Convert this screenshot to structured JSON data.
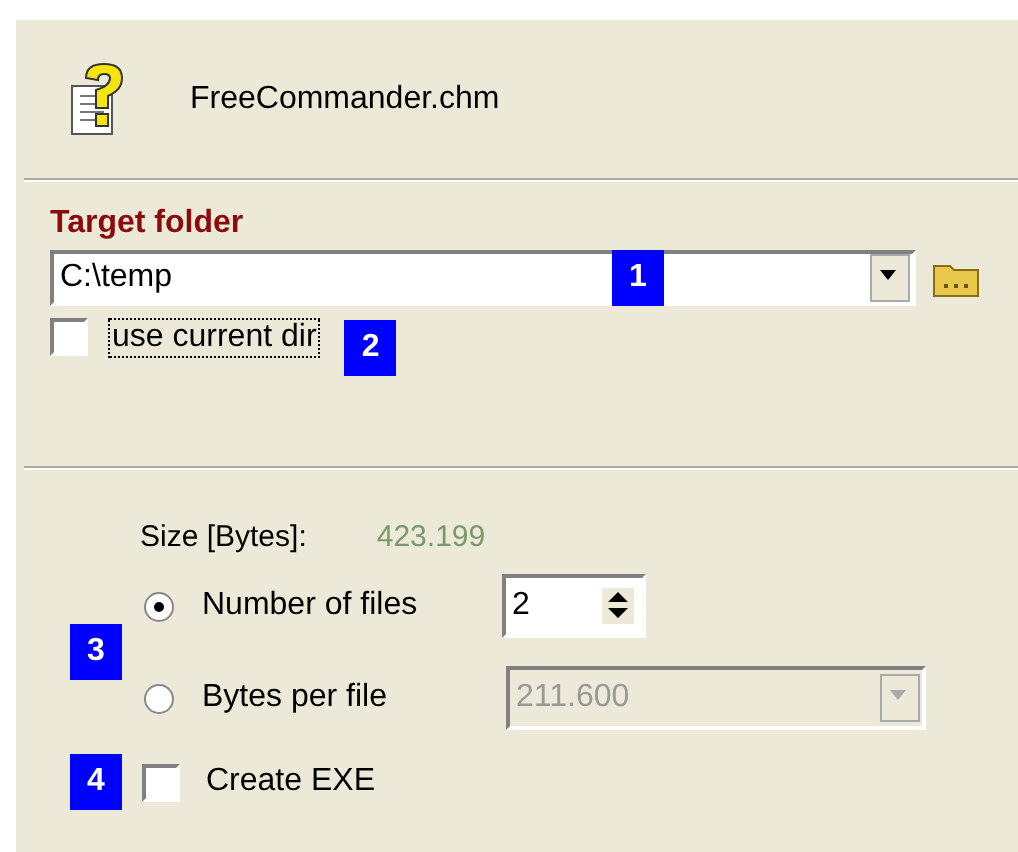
{
  "header": {
    "title": "FreeCommander.chm"
  },
  "target_folder": {
    "label": "Target folder",
    "value": "C:\\temp",
    "marker": "1"
  },
  "use_current_dir": {
    "label": "use current dir",
    "checked": false,
    "focused": true,
    "marker": "2"
  },
  "size": {
    "label": "Size [Bytes]:",
    "value": "423.199"
  },
  "split": {
    "marker": "3",
    "options": [
      {
        "kind": "spin",
        "label": "Number of files",
        "selected": true,
        "value": "2",
        "disabled": false
      },
      {
        "kind": "combo",
        "label": "Bytes per file",
        "selected": false,
        "value": "211.600",
        "disabled": true
      }
    ]
  },
  "create_exe": {
    "label": "Create EXE",
    "checked": false,
    "marker": "4"
  }
}
